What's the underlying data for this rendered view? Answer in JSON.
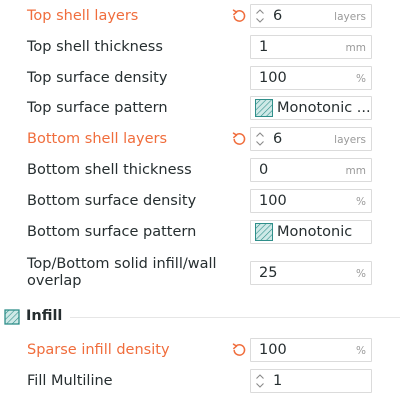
{
  "shell": {
    "top_shell_layers": {
      "label": "Top shell layers",
      "value": "6",
      "unit": "layers"
    },
    "top_shell_thickness": {
      "label": "Top shell thickness",
      "value": "1",
      "unit": "mm"
    },
    "top_surface_density": {
      "label": "Top surface density",
      "value": "100",
      "unit": "%"
    },
    "top_surface_pattern": {
      "label": "Top surface pattern",
      "value": "Monotonic ..."
    },
    "bottom_shell_layers": {
      "label": "Bottom shell layers",
      "value": "6",
      "unit": "layers"
    },
    "bottom_shell_thickness": {
      "label": "Bottom shell thickness",
      "value": "0",
      "unit": "mm"
    },
    "bottom_surface_density": {
      "label": "Bottom surface density",
      "value": "100",
      "unit": "%"
    },
    "bottom_surface_pattern": {
      "label": "Bottom surface pattern",
      "value": "Monotonic"
    },
    "solid_infill_overlap": {
      "label": "Top/Bottom solid infill/wall overlap",
      "value": "25",
      "unit": "%"
    }
  },
  "infill_section": {
    "title": "Infill"
  },
  "infill": {
    "sparse_infill_density": {
      "label": "Sparse infill density",
      "value": "100",
      "unit": "%"
    },
    "fill_multiline": {
      "label": "Fill Multiline",
      "value": "1"
    }
  },
  "colors": {
    "modified": "#F06D3C",
    "text": "#262E30",
    "accent": "#009688"
  }
}
